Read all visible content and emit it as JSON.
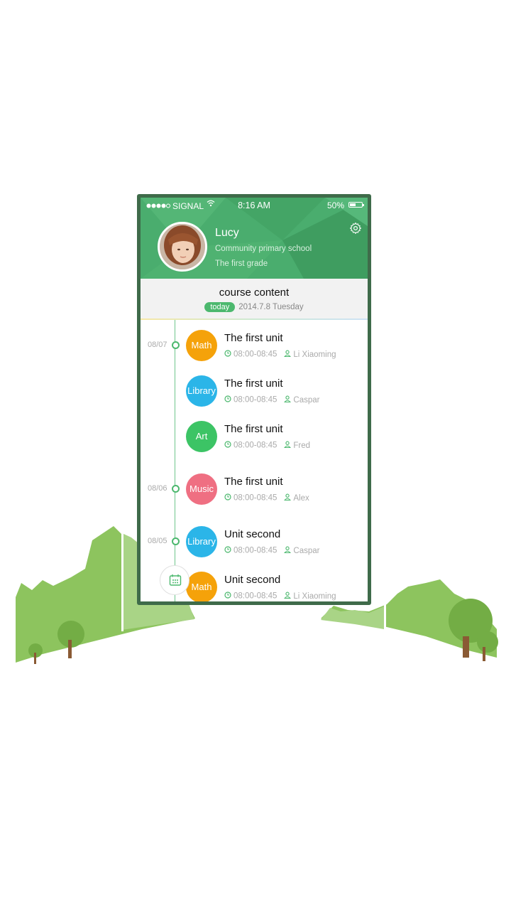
{
  "status_bar": {
    "carrier": "SIGNAL",
    "time": "8:16 AM",
    "battery": "50%"
  },
  "profile": {
    "name": "Lucy",
    "school": "Community primary school",
    "grade": "The first grade"
  },
  "course": {
    "title": "course content",
    "today_badge": "today",
    "date": "2014.7.8 Tuesday"
  },
  "dates": [
    "08/07",
    "08/06",
    "08/05"
  ],
  "courses": [
    {
      "subject": "Math",
      "color": "#f5a20a",
      "title": "The first unit",
      "time": "08:00-08:45",
      "teacher": "Li Xiaoming"
    },
    {
      "subject": "Library",
      "color": "#2bb5e8",
      "title": "The first unit",
      "time": "08:00-08:45",
      "teacher": "Caspar"
    },
    {
      "subject": "Art",
      "color": "#3cc465",
      "title": "The first unit",
      "time": "08:00-08:45",
      "teacher": "Fred"
    },
    {
      "subject": "Music",
      "color": "#ef6f82",
      "title": "The first unit",
      "time": "08:00-08:45",
      "teacher": "Alex"
    },
    {
      "subject": "Library",
      "color": "#2bb5e8",
      "title": "Unit second",
      "time": "08:00-08:45",
      "teacher": "Caspar"
    },
    {
      "subject": "Math",
      "color": "#f5a20a",
      "title": "Unit second",
      "time": "08:00-08:45",
      "teacher": "Li Xiaoming"
    }
  ],
  "icons": {
    "settings": "gear-icon",
    "calendar": "calendar-icon",
    "clock": "clock-icon",
    "person": "person-icon"
  },
  "colors": {
    "header_green": "#4aad6e",
    "accent_green": "#4cb86e",
    "frame": "#3f6b4a"
  }
}
